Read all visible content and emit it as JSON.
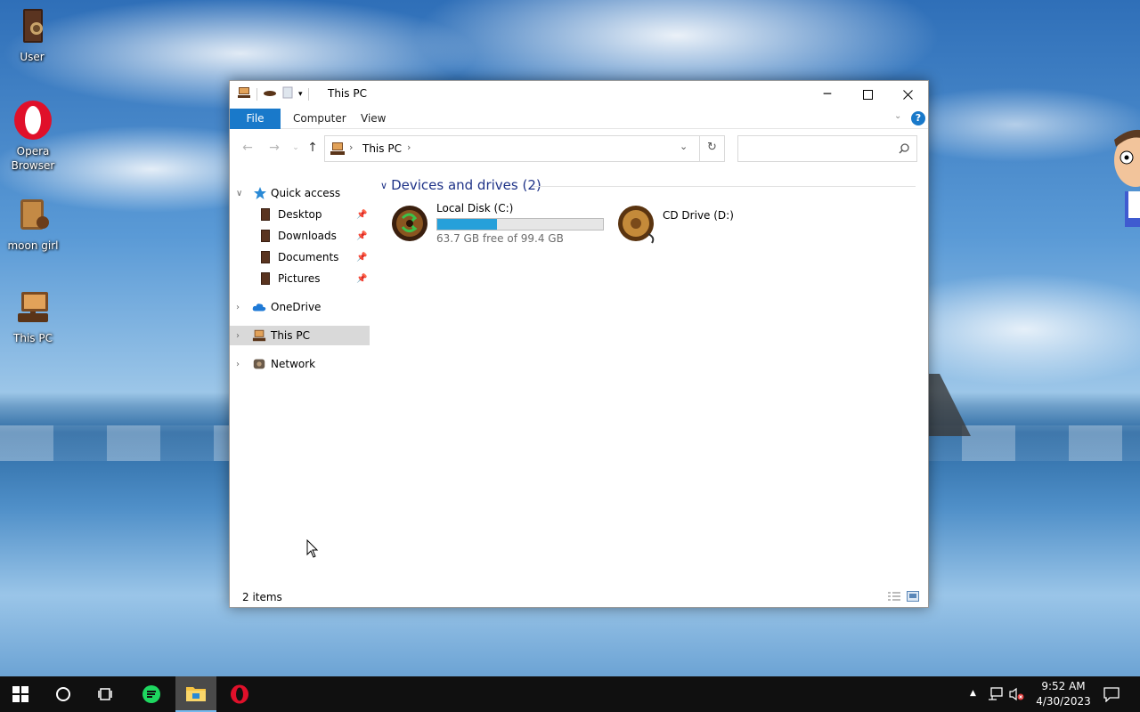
{
  "desktop": {
    "icons": [
      {
        "label": "User",
        "icon": "user-folder-icon"
      },
      {
        "label": "Opera Browser",
        "icon": "opera-icon"
      },
      {
        "label": "moon girl",
        "icon": "moon-girl-icon"
      },
      {
        "label": "This PC",
        "icon": "this-pc-icon"
      }
    ]
  },
  "window": {
    "title": "This PC",
    "ribbon": {
      "file": "File",
      "computer": "Computer",
      "view": "View"
    },
    "address": {
      "crumb": "This PC"
    },
    "search": {
      "placeholder": ""
    },
    "nav": {
      "quick_access": "Quick access",
      "desktop": "Desktop",
      "downloads": "Downloads",
      "documents": "Documents",
      "pictures": "Pictures",
      "onedrive": "OneDrive",
      "this_pc": "This PC",
      "network": "Network"
    },
    "group": {
      "title": "Devices and drives (2)"
    },
    "drives": [
      {
        "name": "Local Disk (C:)",
        "free": "63.7 GB free of 99.4 GB",
        "used_fraction": 0.359
      },
      {
        "name": "CD Drive (D:)"
      }
    ],
    "status": {
      "items": "2 items"
    }
  },
  "taskbar": {
    "time": "9:52 AM",
    "date": "4/30/2023"
  },
  "colors": {
    "accent": "#1979ca",
    "capacity": "#26a0da",
    "group_header": "#1e3287"
  }
}
